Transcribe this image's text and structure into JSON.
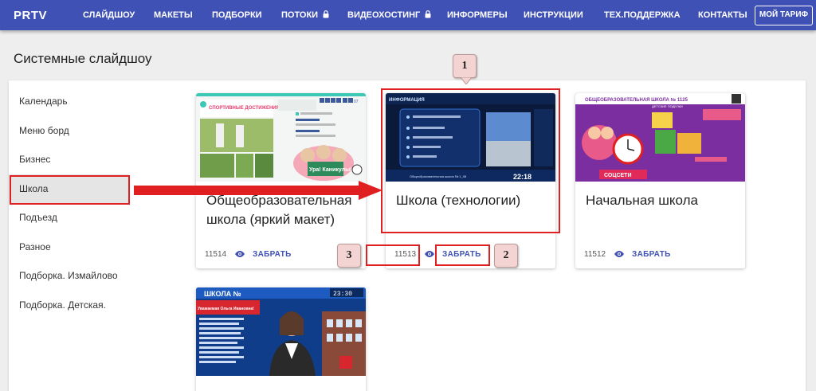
{
  "nav": {
    "brand": "PRTV",
    "items": [
      {
        "label": "СЛАЙДШОУ"
      },
      {
        "label": "МАКЕТЫ"
      },
      {
        "label": "ПОДБОРКИ"
      },
      {
        "label": "ПОТОКИ",
        "locked": true
      },
      {
        "label": "ВИДЕОХОСТИНГ",
        "locked": true
      },
      {
        "label": "ИНФОРМЕРЫ"
      },
      {
        "label": "ИНСТРУКЦИИ"
      },
      {
        "label": "ТЕХ.ПОДДЕРЖКА"
      },
      {
        "label": "КОНТАКТЫ"
      }
    ],
    "tariff_button": "МОЙ ТАРИФ",
    "color": "#3f51b5"
  },
  "page_title": "Системные слайдшоу",
  "sidebar": {
    "items": [
      {
        "label": "Календарь"
      },
      {
        "label": "Меню борд"
      },
      {
        "label": "Бизнес"
      },
      {
        "label": "Школа",
        "active": true
      },
      {
        "label": "Подъезд"
      },
      {
        "label": "Разное"
      },
      {
        "label": "Подборка. Измайлово"
      },
      {
        "label": "Подборка. Детская."
      }
    ]
  },
  "cards": [
    {
      "title": "Общеобразовательная школа (яркий макет)",
      "views": "11514",
      "action": "ЗАБРАТЬ",
      "thumb_text": [
        "СПОРТИВНЫЕ ДОСТИЖЕНИЯ",
        "07",
        "Ура! Каникулы!"
      ]
    },
    {
      "title": "Школа (технологии)",
      "views": "11513",
      "action": "ЗАБРАТЬ",
      "thumb_text": [
        "ИНФОРМАЦИЯ",
        "22:18",
        "Общеобразовательная школа № 1_08"
      ]
    },
    {
      "title": "Начальная школа",
      "views": "11512",
      "action": "ЗАБРАТЬ",
      "thumb_text": [
        "ОБЩЕОБРАЗОВАТЕЛЬНАЯ ШКОЛА № 1125",
        "СОЦСЕТИ",
        "ДЕТСКИЕ ПОДЕЛКИ"
      ]
    },
    {
      "title": "",
      "views": "",
      "action": "",
      "thumb_text": [
        "ШКОЛА №",
        "23:30",
        "Уважаемая Ольга Ивановна!"
      ]
    }
  ],
  "annotations": {
    "badges": [
      "1",
      "2",
      "3"
    ],
    "color": "#e02020"
  },
  "colors": {
    "accent": "#3f51b5",
    "annotation": "#e02020",
    "sidebar_active": "#e5e5e5"
  }
}
